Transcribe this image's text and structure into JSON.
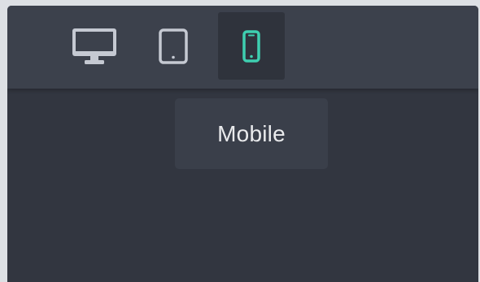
{
  "toolbar": {
    "devices": [
      {
        "icon": "desktop-icon",
        "active": false
      },
      {
        "icon": "tablet-icon",
        "active": false
      },
      {
        "icon": "mobile-icon",
        "active": true
      }
    ]
  },
  "tooltip": {
    "label": "Mobile"
  },
  "colors": {
    "background": "#323640",
    "toolbar": "#3c414c",
    "icon_inactive": "#c5c9d2",
    "icon_active": "#3ecfb0",
    "active_button_bg": "#2f333c",
    "tooltip_bg": "#3a3f4a",
    "tooltip_text": "#e9eaec"
  }
}
